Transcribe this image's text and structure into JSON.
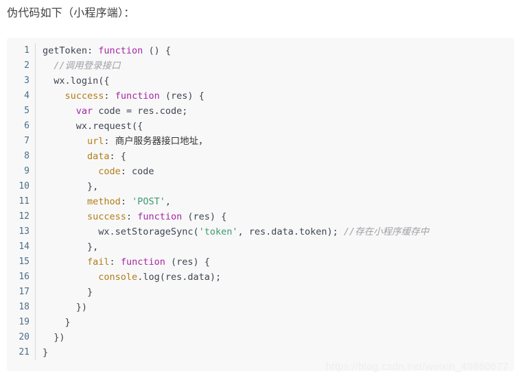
{
  "document": {
    "intro_text": "伪代码如下（小程序端）：",
    "watermark": "https://blog.csdn.net/weixin_49860677",
    "code_block": {
      "language": "javascript",
      "line_count": 21,
      "background_color": "#f8f8f8",
      "colors": {
        "keyword": "#a625a4",
        "property": "#b07d18",
        "string": "#3d9970",
        "comment": "#a0a1a7",
        "plain": "#3d4450",
        "line_number": "#4a6e8a"
      },
      "lines": [
        {
          "number": "1",
          "text": "getToken: function () {"
        },
        {
          "number": "2",
          "text": "  //调用登录接口"
        },
        {
          "number": "3",
          "text": "  wx.login({"
        },
        {
          "number": "4",
          "text": "    success: function (res) {"
        },
        {
          "number": "5",
          "text": "      var code = res.code;"
        },
        {
          "number": "6",
          "text": "      wx.request({"
        },
        {
          "number": "7",
          "text": "        url: 商户服务器接口地址，"
        },
        {
          "number": "8",
          "text": "        data: {"
        },
        {
          "number": "9",
          "text": "          code: code"
        },
        {
          "number": "10",
          "text": "        },"
        },
        {
          "number": "11",
          "text": "        method: 'POST',"
        },
        {
          "number": "12",
          "text": "        success: function (res) {"
        },
        {
          "number": "13",
          "text": "          wx.setStorageSync('token', res.data.token); //存在小程序缓存中"
        },
        {
          "number": "14",
          "text": "        },"
        },
        {
          "number": "15",
          "text": "        fail: function (res) {"
        },
        {
          "number": "16",
          "text": "          console.log(res.data);"
        },
        {
          "number": "17",
          "text": "        }"
        },
        {
          "number": "18",
          "text": "      })"
        },
        {
          "number": "19",
          "text": "    }"
        },
        {
          "number": "20",
          "text": "  })"
        },
        {
          "number": "21",
          "text": "}"
        }
      ],
      "tokens": [
        [
          {
            "t": "getToken: ",
            "c": "plain"
          },
          {
            "t": "function",
            "c": "kw"
          },
          {
            "t": " () {",
            "c": "plain"
          }
        ],
        [
          {
            "t": "  ",
            "c": "plain"
          },
          {
            "t": "//调用登录接口",
            "c": "comment"
          }
        ],
        [
          {
            "t": "  wx.login({",
            "c": "plain"
          }
        ],
        [
          {
            "t": "    ",
            "c": "plain"
          },
          {
            "t": "success",
            "c": "prop"
          },
          {
            "t": ": ",
            "c": "plain"
          },
          {
            "t": "function",
            "c": "kw"
          },
          {
            "t": " (res) {",
            "c": "plain"
          }
        ],
        [
          {
            "t": "      ",
            "c": "plain"
          },
          {
            "t": "var",
            "c": "kw"
          },
          {
            "t": " code = res.code;",
            "c": "plain"
          }
        ],
        [
          {
            "t": "      wx.request({",
            "c": "plain"
          }
        ],
        [
          {
            "t": "        ",
            "c": "plain"
          },
          {
            "t": "url",
            "c": "prop"
          },
          {
            "t": ": ",
            "c": "plain"
          },
          {
            "t": "商户服务器接口地址，",
            "c": "cjk"
          }
        ],
        [
          {
            "t": "        ",
            "c": "plain"
          },
          {
            "t": "data",
            "c": "prop"
          },
          {
            "t": ": {",
            "c": "plain"
          }
        ],
        [
          {
            "t": "          ",
            "c": "plain"
          },
          {
            "t": "code",
            "c": "prop"
          },
          {
            "t": ": code",
            "c": "plain"
          }
        ],
        [
          {
            "t": "        },",
            "c": "plain"
          }
        ],
        [
          {
            "t": "        ",
            "c": "plain"
          },
          {
            "t": "method",
            "c": "prop"
          },
          {
            "t": ": ",
            "c": "plain"
          },
          {
            "t": "'POST'",
            "c": "str"
          },
          {
            "t": ",",
            "c": "plain"
          }
        ],
        [
          {
            "t": "        ",
            "c": "plain"
          },
          {
            "t": "success",
            "c": "prop"
          },
          {
            "t": ": ",
            "c": "plain"
          },
          {
            "t": "function",
            "c": "kw"
          },
          {
            "t": " (res) {",
            "c": "plain"
          }
        ],
        [
          {
            "t": "          wx.setStorageSync(",
            "c": "plain"
          },
          {
            "t": "'token'",
            "c": "str"
          },
          {
            "t": ", res.data.token); ",
            "c": "plain"
          },
          {
            "t": "//存在小程序缓存中",
            "c": "comment"
          }
        ],
        [
          {
            "t": "        },",
            "c": "plain"
          }
        ],
        [
          {
            "t": "        ",
            "c": "plain"
          },
          {
            "t": "fail",
            "c": "prop"
          },
          {
            "t": ": ",
            "c": "plain"
          },
          {
            "t": "function",
            "c": "kw"
          },
          {
            "t": " (res) {",
            "c": "plain"
          }
        ],
        [
          {
            "t": "          ",
            "c": "plain"
          },
          {
            "t": "console",
            "c": "prop"
          },
          {
            "t": ".log(res.data);",
            "c": "plain"
          }
        ],
        [
          {
            "t": "        }",
            "c": "plain"
          }
        ],
        [
          {
            "t": "      })",
            "c": "plain"
          }
        ],
        [
          {
            "t": "    }",
            "c": "plain"
          }
        ],
        [
          {
            "t": "  })",
            "c": "plain"
          }
        ],
        [
          {
            "t": "}",
            "c": "plain"
          }
        ]
      ]
    }
  }
}
